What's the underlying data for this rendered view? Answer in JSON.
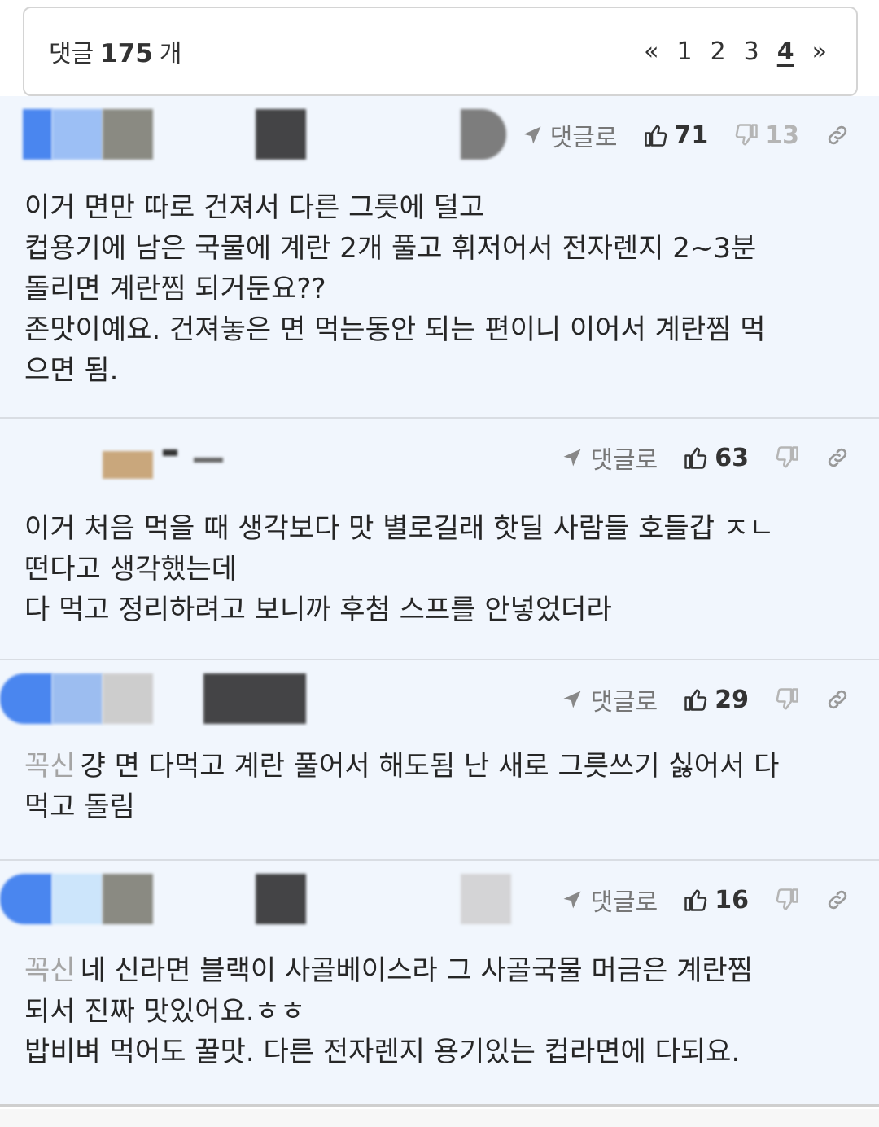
{
  "header": {
    "count_prefix": "댓글",
    "count_value": "175",
    "count_suffix": "개",
    "pagination": {
      "first": "«",
      "pages": [
        "1",
        "2",
        "3",
        "4"
      ],
      "current": "4",
      "last": "»"
    }
  },
  "reply_label": "댓글로",
  "comments": [
    {
      "likes": "71",
      "dislikes": "13",
      "mention": "",
      "text": "이거 면만 따로 건져서 다른 그릇에 덜고\n컵용기에 남은 국물에 계란 2개 풀고 휘저어서 전자렌지 2~3분\n돌리면 계란찜 되거둔요??\n존맛이예요. 건져놓은 면 먹는동안 되는 편이니 이어서 계란찜 먹\n으면 됨."
    },
    {
      "likes": "63",
      "dislikes": "",
      "mention": "",
      "text": "이거 처음 먹을 때 생각보다 맛 별로길래 핫딜 사람들 호들갑 ㅈㄴ\n떤다고 생각했는데\n다 먹고 정리하려고 보니까 후첨 스프를 안넣었더라"
    },
    {
      "likes": "29",
      "dislikes": "",
      "mention": "꼭신",
      "text": "걍 면 다먹고 계란 풀어서 해도됨 난 새로 그릇쓰기 싫어서 다\n먹고 돌림"
    },
    {
      "likes": "16",
      "dislikes": "",
      "mention": "꼭신",
      "text": "네 신라면 블랙이 사골베이스라 그 사골국물 머금은 계란찜\n되서 진짜 맛있어요.ㅎㅎ\n밥비벼 먹어도 꿀맛. 다른 전자렌지 용기있는 컵라면에 다되요."
    }
  ],
  "colors": {
    "comment_bg": "#f1f6fd",
    "divider": "#d9dde3",
    "mention": "#a5a5a5"
  }
}
